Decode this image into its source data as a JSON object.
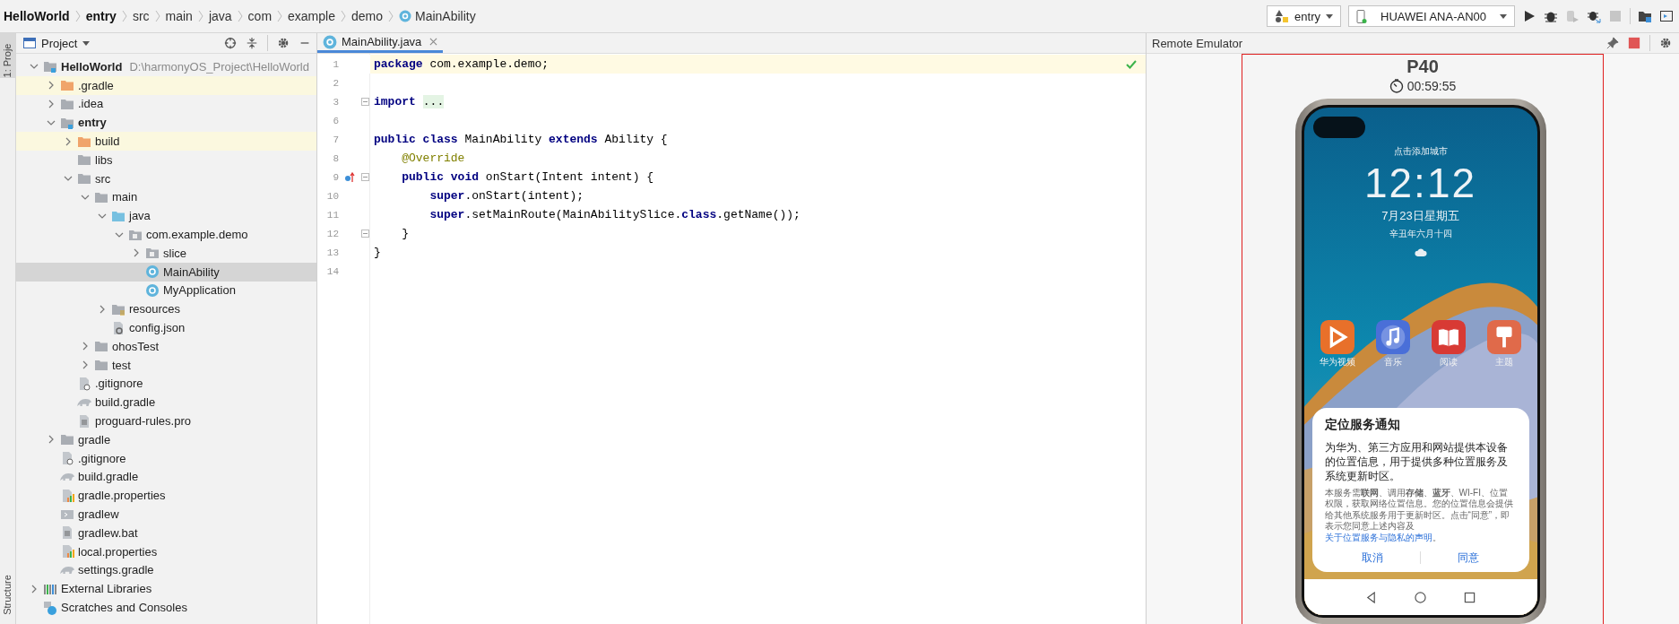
{
  "breadcrumb": [
    {
      "label": "HelloWorld",
      "bold": true,
      "kind": "folder"
    },
    {
      "label": "entry",
      "bold": true,
      "kind": "folder"
    },
    {
      "label": "src",
      "bold": false,
      "kind": "folder"
    },
    {
      "label": "main",
      "bold": false,
      "kind": "folder"
    },
    {
      "label": "java",
      "bold": false,
      "kind": "folder"
    },
    {
      "label": "com",
      "bold": false,
      "kind": "folder"
    },
    {
      "label": "example",
      "bold": false,
      "kind": "folder"
    },
    {
      "label": "demo",
      "bold": false,
      "kind": "folder"
    },
    {
      "label": "MainAbility",
      "bold": false,
      "kind": "class"
    }
  ],
  "run_config": "entry",
  "device": "HUAWEI ANA-AN00",
  "side_tabs": [
    {
      "label": "1: Proje",
      "selected": true
    },
    {
      "label": "Structure",
      "selected": false
    }
  ],
  "project_panel": {
    "title": "Project",
    "tree": [
      {
        "label": "HelloWorld",
        "path": "D:\\harmonyOS_Project\\HelloWorld",
        "kind": "module",
        "expanded": true,
        "selected": false,
        "children": [
          {
            "label": ".gradle",
            "kind": "excluded-folder",
            "expanded": false,
            "selected": false
          },
          {
            "label": ".idea",
            "kind": "folder",
            "expanded": false,
            "selected": false
          },
          {
            "label": "entry",
            "kind": "module",
            "expanded": true,
            "selected": false,
            "children": [
              {
                "label": "build",
                "kind": "excluded-folder",
                "expanded": false,
                "selected": false
              },
              {
                "label": "libs",
                "kind": "folder",
                "selected": false
              },
              {
                "label": "src",
                "kind": "folder",
                "expanded": true,
                "selected": false,
                "children": [
                  {
                    "label": "main",
                    "kind": "folder",
                    "expanded": true,
                    "selected": false,
                    "children": [
                      {
                        "label": "java",
                        "kind": "source-folder",
                        "expanded": true,
                        "selected": false,
                        "children": [
                          {
                            "label": "com.example.demo",
                            "kind": "package",
                            "expanded": true,
                            "selected": false,
                            "children": [
                              {
                                "label": "slice",
                                "kind": "package",
                                "expanded": false,
                                "selected": false
                              },
                              {
                                "label": "MainAbility",
                                "kind": "class",
                                "selected": true
                              },
                              {
                                "label": "MyApplication",
                                "kind": "class",
                                "selected": false
                              }
                            ]
                          }
                        ]
                      },
                      {
                        "label": "resources",
                        "kind": "resources",
                        "expanded": false,
                        "selected": false
                      },
                      {
                        "label": "config.json",
                        "kind": "json",
                        "selected": false
                      }
                    ]
                  },
                  {
                    "label": "ohosTest",
                    "kind": "folder",
                    "expanded": false,
                    "selected": false
                  },
                  {
                    "label": "test",
                    "kind": "folder",
                    "expanded": false,
                    "selected": false
                  }
                ]
              },
              {
                "label": ".gitignore",
                "kind": "gitignore",
                "selected": false
              },
              {
                "label": "build.gradle",
                "kind": "gradle",
                "selected": false
              },
              {
                "label": "proguard-rules.pro",
                "kind": "text",
                "selected": false
              }
            ]
          },
          {
            "label": "gradle",
            "kind": "folder",
            "expanded": false,
            "selected": false
          },
          {
            "label": ".gitignore",
            "kind": "gitignore",
            "selected": false
          },
          {
            "label": "build.gradle",
            "kind": "gradle",
            "selected": false
          },
          {
            "label": "gradle.properties",
            "kind": "properties",
            "selected": false
          },
          {
            "label": "gradlew",
            "kind": "shell",
            "selected": false
          },
          {
            "label": "gradlew.bat",
            "kind": "text",
            "selected": false
          },
          {
            "label": "local.properties",
            "kind": "properties",
            "selected": false
          },
          {
            "label": "settings.gradle",
            "kind": "gradle",
            "selected": false
          }
        ]
      },
      {
        "label": "External Libraries",
        "kind": "libraries",
        "expanded": false,
        "selected": false
      },
      {
        "label": "Scratches and Consoles",
        "kind": "scratches",
        "selected": false
      }
    ]
  },
  "editor": {
    "tabs": [
      {
        "label": "MainAbility.java",
        "selected": true
      }
    ],
    "lines": [
      {
        "number": "1",
        "current": true,
        "fold": false,
        "override": false,
        "tokens": [
          {
            "text": "package",
            "kind": "keyword"
          },
          {
            "text": " com.example.demo;",
            "kind": "plain"
          }
        ]
      },
      {
        "number": "2",
        "current": false,
        "fold": false,
        "override": false
      },
      {
        "number": "3",
        "current": false,
        "fold": true,
        "override": false,
        "tokens": [
          {
            "text": "import",
            "kind": "keyword"
          },
          {
            "text": "...",
            "kind": "folded"
          }
        ]
      },
      {
        "number": "6",
        "current": false,
        "fold": false,
        "override": false
      },
      {
        "number": "7",
        "current": false,
        "fold": false,
        "override": false,
        "tokens": [
          {
            "text": "public class",
            "kind": "keyword"
          },
          {
            "text": " MainAbility ",
            "kind": "plain"
          },
          {
            "text": "extends",
            "kind": "keyword"
          },
          {
            "text": " Ability {",
            "kind": "plain"
          }
        ]
      },
      {
        "number": "8",
        "current": false,
        "fold": false,
        "override": false,
        "tokens": [
          {
            "text": "    @Override",
            "kind": "annotation"
          }
        ]
      },
      {
        "number": "9",
        "current": false,
        "fold": true,
        "override": true,
        "tokens": [
          {
            "text": "    public void",
            "kind": "keyword"
          },
          {
            "text": " onStart(Intent intent) {",
            "kind": "plain"
          }
        ]
      },
      {
        "number": "10",
        "current": false,
        "fold": false,
        "override": false,
        "tokens": [
          {
            "text": "        super",
            "kind": "keyword"
          },
          {
            "text": ".onStart(intent);",
            "kind": "plain"
          }
        ]
      },
      {
        "number": "11",
        "current": false,
        "fold": false,
        "override": false,
        "tokens": [
          {
            "text": "        super",
            "kind": "keyword"
          },
          {
            "text": ".setMainRoute(MainAbilitySlice.",
            "kind": "plain"
          },
          {
            "text": "class",
            "kind": "keyword"
          },
          {
            "text": ".getName());",
            "kind": "plain"
          }
        ]
      },
      {
        "number": "12",
        "current": false,
        "fold": true,
        "override": false,
        "tokens": [
          {
            "text": "    }",
            "kind": "plain"
          }
        ]
      },
      {
        "number": "13",
        "current": false,
        "fold": false,
        "override": false,
        "tokens": [
          {
            "text": "}",
            "kind": "plain"
          }
        ]
      },
      {
        "number": "14",
        "current": false,
        "fold": false,
        "override": false
      }
    ]
  },
  "emulator": {
    "title": "Remote Emulator",
    "device": "P40",
    "timer": "00:59:55",
    "lock_screen": {
      "city": "点击添加城市",
      "time": "12:12",
      "date": "7月23日星期五",
      "lunar": "辛丑年六月十四"
    },
    "apps": [
      {
        "label": "华为视频",
        "kind": "video",
        "color": "#e8702a"
      },
      {
        "label": "音乐",
        "kind": "music",
        "color": "#4a6fd8"
      },
      {
        "label": "阅读",
        "kind": "book",
        "color": "#d83a34"
      },
      {
        "label": "主题",
        "kind": "brush",
        "color": "#e06a4a"
      }
    ],
    "dialog": {
      "title": "定位服务通知",
      "body": "为华为、第三方应用和网站提供本设备的位置信息，用于提供多种位置服务及系统更新时区。",
      "detail": "本服务需**联网**、调用**存储**、**蓝牙**、WI-FI、位置权限，获取网络位置信息。您的位置信息会提供给其他系统服务用于更新时区。点击“同意”，即表示您同意上述内容及",
      "link": "关于位置服务与隐私的声明",
      "detail_end": "。",
      "buttons": [
        {
          "label": "取消"
        },
        {
          "label": "同意"
        }
      ]
    }
  }
}
